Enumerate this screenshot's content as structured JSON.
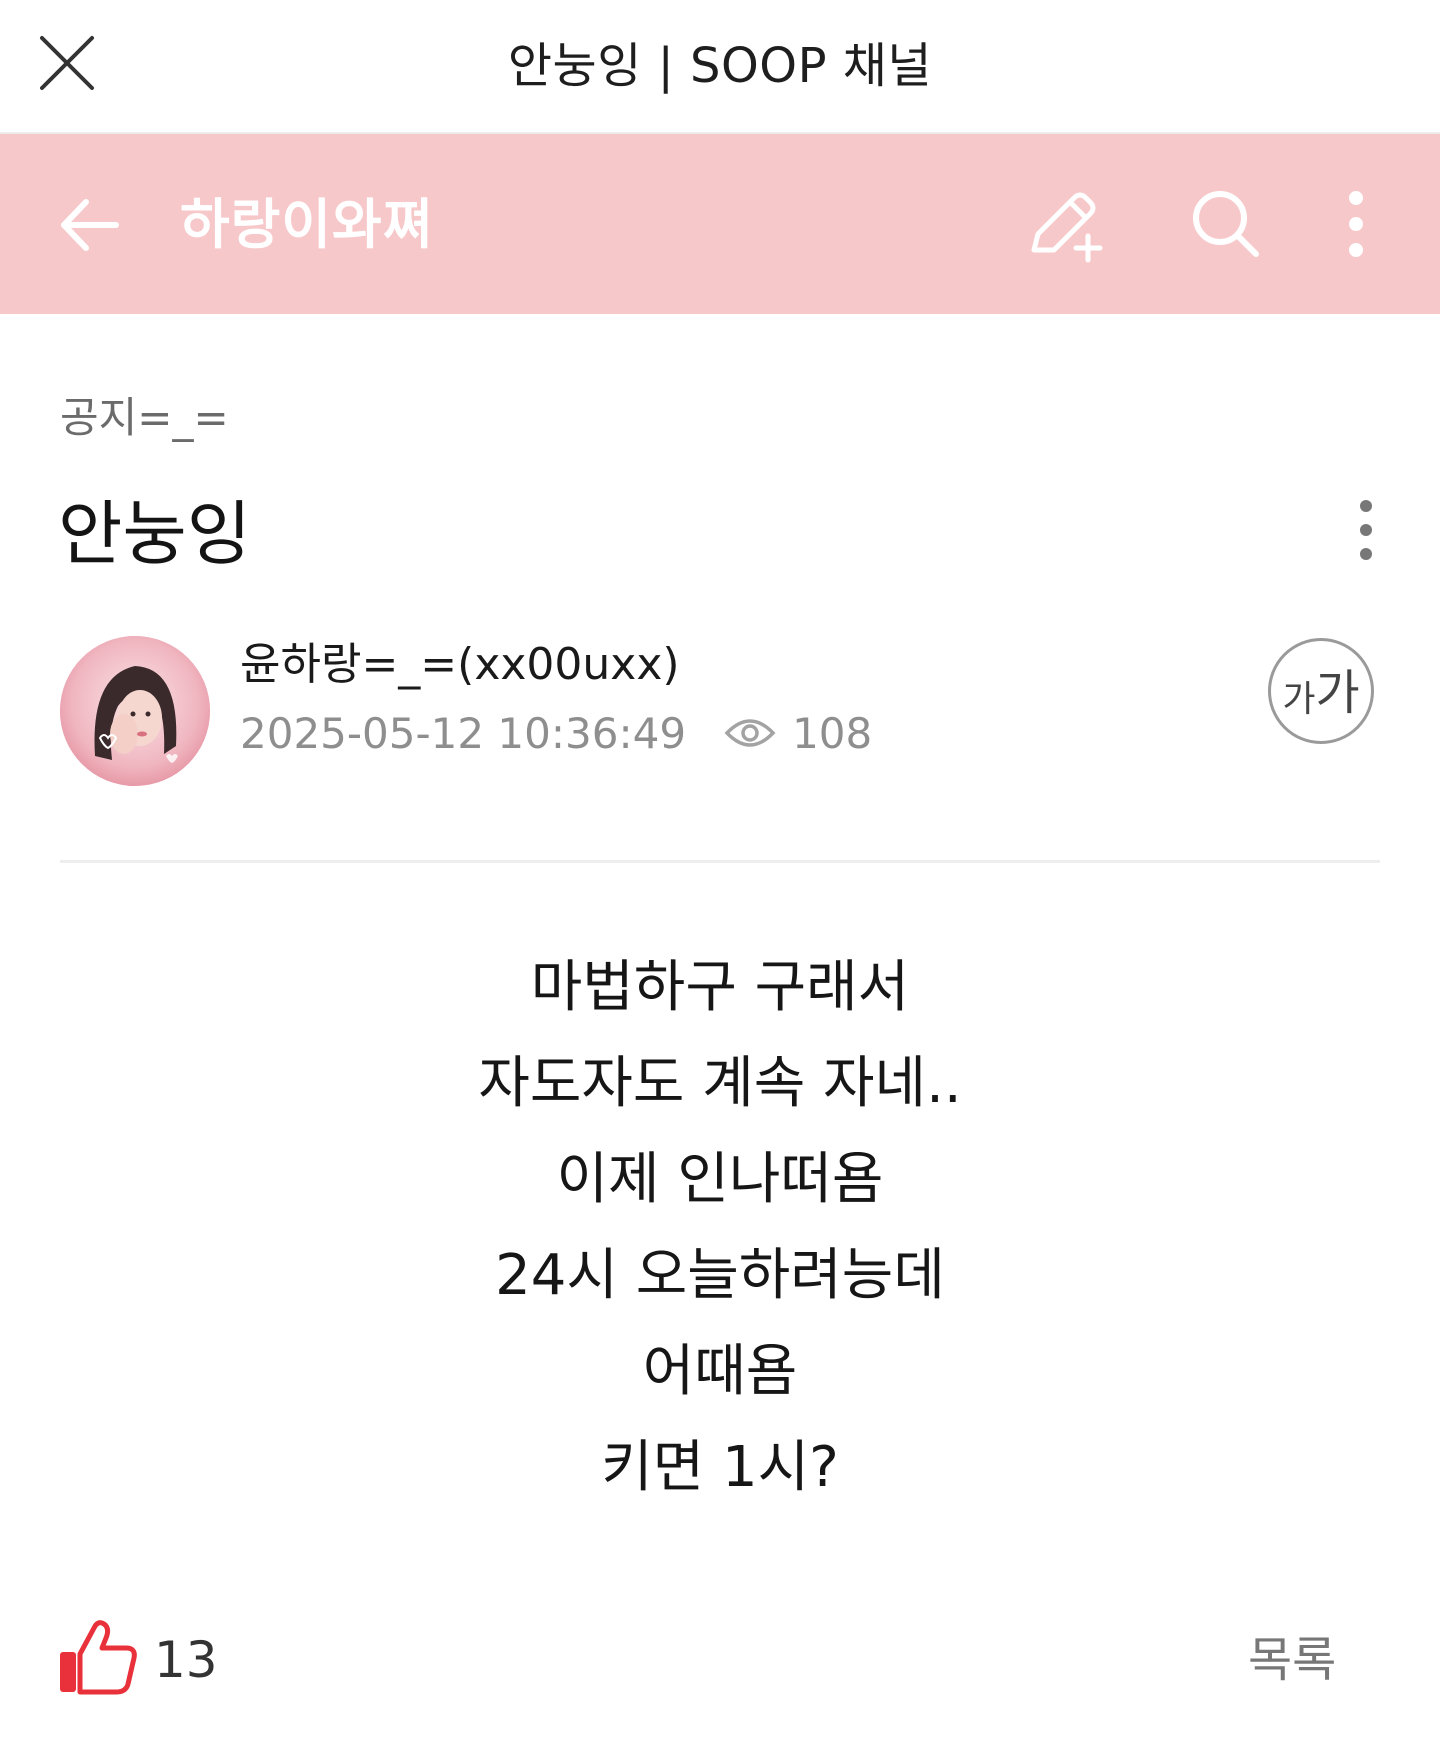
{
  "window": {
    "title": "안눙잉 | SOOP 채널",
    "close_icon": "close-icon"
  },
  "header": {
    "channel_name": "하랑이와쪄",
    "background_color": "#f7c8ca",
    "icons": [
      "back-arrow-icon",
      "write-icon",
      "search-icon",
      "more-vertical-icon"
    ]
  },
  "post": {
    "category": "공지=_=",
    "title": "안눙잉",
    "author": "윤하랑=_=(xx00uxx)",
    "datetime": "2025-05-12 10:36:49",
    "views": "108",
    "font_size_button": {
      "small": "가",
      "big": "가"
    },
    "body_lines": [
      "마법하구 구래서",
      "자도자도 계속 자네..",
      "이제 인나떠욤",
      "24시 오늘하려능데",
      "어때욤",
      "키면 1시?"
    ]
  },
  "footer": {
    "like_count": "13",
    "like_color": "#e8313a",
    "list_label": "목록"
  }
}
